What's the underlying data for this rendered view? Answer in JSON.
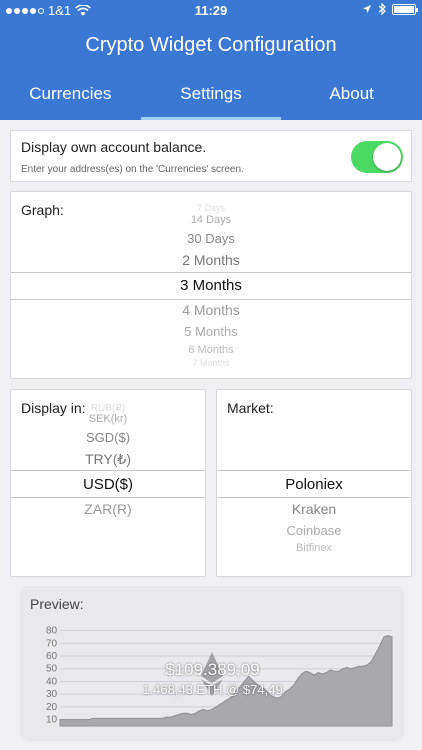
{
  "status_bar": {
    "carrier": "1&1",
    "time": "11:29"
  },
  "header": {
    "title": "Crypto Widget Configuration",
    "tabs": [
      {
        "label": "Currencies"
      },
      {
        "label": "Settings"
      },
      {
        "label": "About"
      }
    ],
    "active_tab": "Settings"
  },
  "account_balance": {
    "label": "Display own account balance.",
    "hint": "Enter your address(es) on the 'Currencies' screen.",
    "enabled": true,
    "toggle_color": "#4cd964"
  },
  "graph": {
    "label": "Graph:",
    "options": [
      "7 Days",
      "14 Days",
      "30 Days",
      "2 Months",
      "3 Months",
      "4 Months",
      "5 Months",
      "6 Months",
      "7 Months"
    ],
    "selected": "3 Months"
  },
  "display_in": {
    "label": "Display in:",
    "options": [
      "RUB(₽)",
      "SEK(kr)",
      "SGD($)",
      "TRY(₺)",
      "USD($)",
      "ZAR(R)"
    ],
    "selected": "USD($)"
  },
  "market": {
    "label": "Market:",
    "options": [
      "Poloniex",
      "Kraken",
      "Coinbase",
      "Bitfinex"
    ],
    "selected": "Poloniex"
  },
  "preview": {
    "label": "Preview:",
    "balance": "$109.389,09",
    "holding": "1.468,43 ETH @ $74,49"
  },
  "chart_data": {
    "type": "area",
    "y_ticks": [
      10,
      20,
      30,
      40,
      50,
      60,
      70,
      80
    ],
    "ylim": [
      5,
      82
    ],
    "values": [
      10,
      10,
      10,
      10,
      10,
      10,
      10,
      10,
      11,
      11,
      11,
      11,
      11,
      11,
      11,
      11,
      11,
      11,
      11,
      11,
      11,
      11,
      11,
      11,
      11,
      11,
      12,
      12,
      13,
      14,
      15,
      15,
      14,
      15,
      17,
      18,
      17,
      18,
      20,
      22,
      24,
      26,
      28,
      32,
      36,
      40,
      44,
      41,
      38,
      36,
      34,
      30,
      28,
      27,
      28,
      32,
      34,
      37,
      42,
      46,
      48,
      47,
      45,
      47,
      46,
      47,
      49,
      48,
      48,
      50,
      51,
      50,
      51,
      52,
      52,
      53,
      56,
      62,
      68,
      75,
      76,
      75
    ],
    "grid": true
  },
  "colors": {
    "header": "#3a78d4",
    "tab_indicator": "#9ed0ff"
  }
}
